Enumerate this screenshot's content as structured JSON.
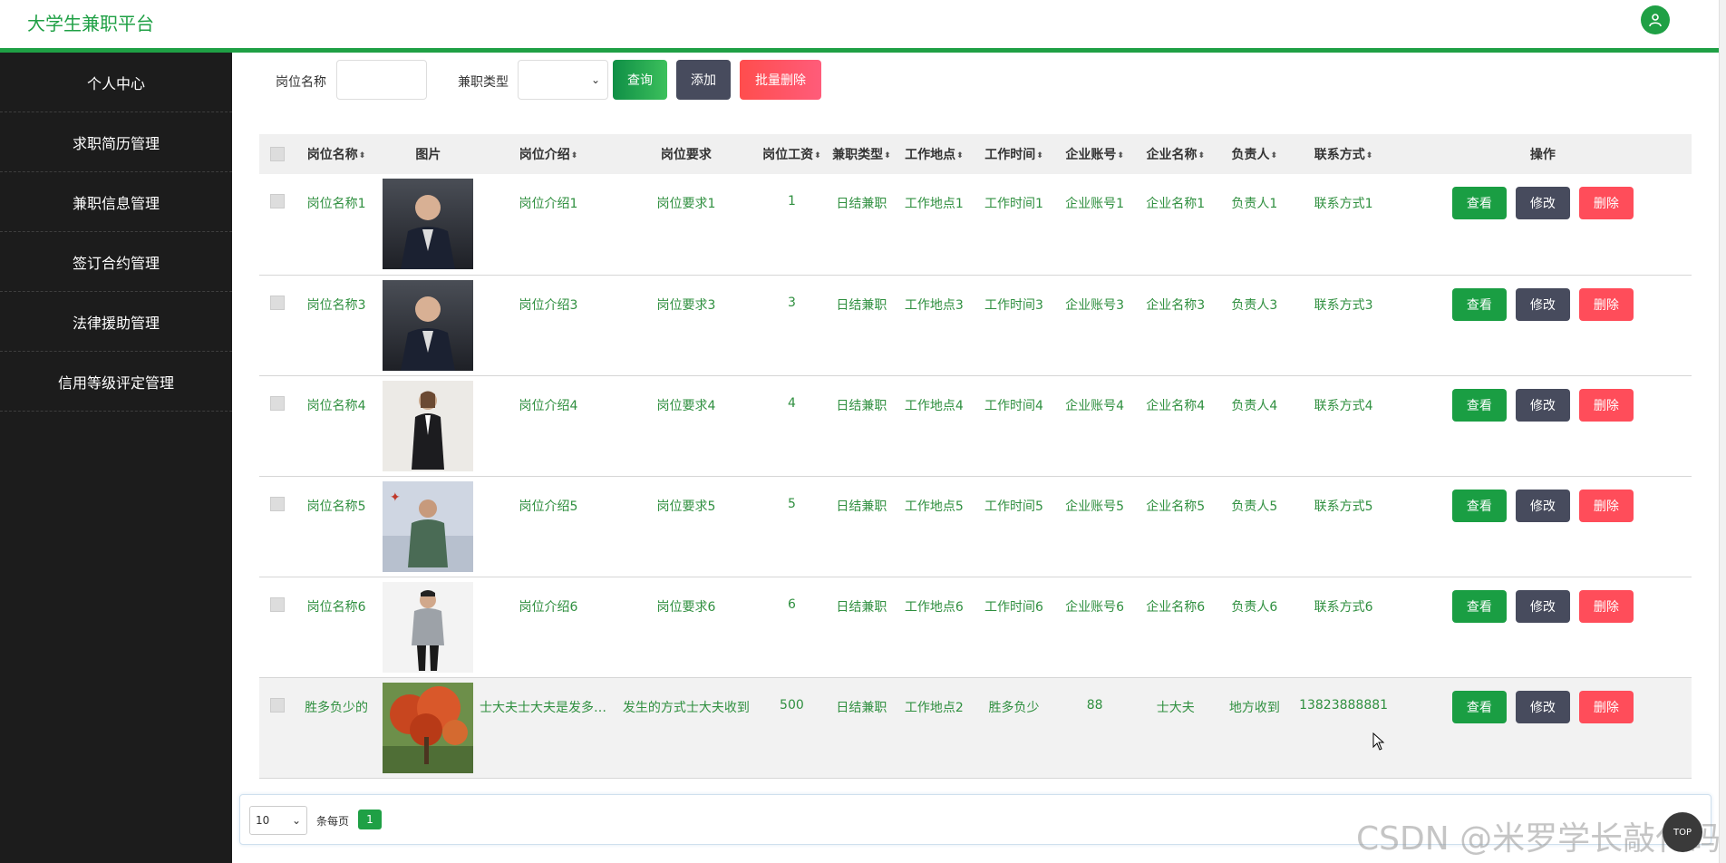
{
  "header": {
    "brand": "大学生兼职平台",
    "user_icon": "user-icon",
    "accent": "#1fa045"
  },
  "sidebar": {
    "items": [
      {
        "label": "个人中心"
      },
      {
        "label": "求职简历管理"
      },
      {
        "label": "兼职信息管理"
      },
      {
        "label": "签订合约管理"
      },
      {
        "label": "法律援助管理"
      },
      {
        "label": "信用等级评定管理"
      }
    ]
  },
  "filters": {
    "name_label": "岗位名称",
    "name_value": "",
    "type_label": "兼职类型",
    "type_value": "",
    "query_label": "查询",
    "add_label": "添加",
    "batch_delete_label": "批量删除"
  },
  "table": {
    "headers": {
      "name": "岗位名称",
      "image": "图片",
      "intro": "岗位介绍",
      "requirement": "岗位要求",
      "salary": "岗位工资",
      "type": "兼职类型",
      "location": "工作地点",
      "time": "工作时间",
      "account": "企业账号",
      "company": "企业名称",
      "owner": "负责人",
      "contact": "联系方式",
      "actions": "操作"
    },
    "action_labels": {
      "view": "查看",
      "edit": "修改",
      "delete": "删除"
    },
    "rows": [
      {
        "name": "岗位名称1",
        "image": "portrait-man-suit",
        "intro": "岗位介绍1",
        "requirement": "岗位要求1",
        "salary": "1",
        "type": "日结兼职",
        "location": "工作地点1",
        "time": "工作时间1",
        "account": "企业账号1",
        "company": "企业名称1",
        "owner": "负责人1",
        "contact": "联系方式1"
      },
      {
        "name": "岗位名称3",
        "image": "portrait-man-suit",
        "intro": "岗位介绍3",
        "requirement": "岗位要求3",
        "salary": "3",
        "type": "日结兼职",
        "location": "工作地点3",
        "time": "工作时间3",
        "account": "企业账号3",
        "company": "企业名称3",
        "owner": "负责人3",
        "contact": "联系方式3"
      },
      {
        "name": "岗位名称4",
        "image": "portrait-woman",
        "intro": "岗位介绍4",
        "requirement": "岗位要求4",
        "salary": "4",
        "type": "日结兼职",
        "location": "工作地点4",
        "time": "工作时间4",
        "account": "企业账号4",
        "company": "企业名称4",
        "owner": "负责人4",
        "contact": "联系方式4"
      },
      {
        "name": "岗位名称5",
        "image": "portrait-man-seated",
        "intro": "岗位介绍5",
        "requirement": "岗位要求5",
        "salary": "5",
        "type": "日结兼职",
        "location": "工作地点5",
        "time": "工作时间5",
        "account": "企业账号5",
        "company": "企业名称5",
        "owner": "负责人5",
        "contact": "联系方式5"
      },
      {
        "name": "岗位名称6",
        "image": "portrait-man-jacket",
        "intro": "岗位介绍6",
        "requirement": "岗位要求6",
        "salary": "6",
        "type": "日结兼职",
        "location": "工作地点6",
        "time": "工作时间6",
        "account": "企业账号6",
        "company": "企业名称6",
        "owner": "负责人6",
        "contact": "联系方式6"
      },
      {
        "name": "胜多负少的",
        "image": "landscape-red-tree",
        "intro": "士大夫士大夫是发多少...",
        "requirement": "发生的方式士大夫收到",
        "salary": "500",
        "type": "日结兼职",
        "location": "工作地点2",
        "time": "胜多负少",
        "account": "88",
        "company": "士大夫",
        "owner": "地方收到",
        "contact": "13823888881"
      }
    ]
  },
  "pagination": {
    "page_size": "10",
    "page_size_label": "条每页",
    "current_page": "1"
  },
  "watermark": "CSDN @米罗学长敲代码",
  "back_to_top": "TOP"
}
